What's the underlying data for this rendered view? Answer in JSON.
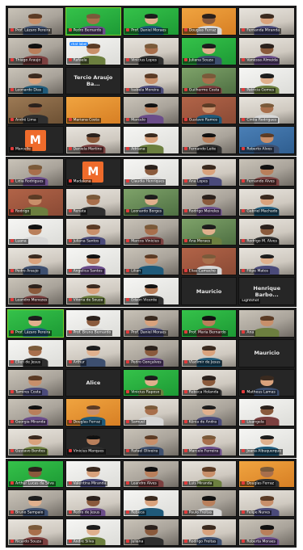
{
  "sheets": [
    {
      "tiles": [
        {
          "name": "Prof. Lázaro Pereira",
          "bg": "bg-office",
          "name_bind": "sheets.0.tiles.0.name"
        },
        {
          "name": "Pedro Bernardo",
          "bg": "bg-green",
          "active": true,
          "name_bind": "sheets.0.tiles.1.name"
        },
        {
          "name": "Prof. Daniel Moraes",
          "bg": "bg-green",
          "name_bind": "sheets.0.tiles.2.name"
        },
        {
          "name": "Douglas Ferraz",
          "bg": "bg-orange-room",
          "name_bind": "sheets.0.tiles.3.name"
        },
        {
          "name": "Fernanda Miranda",
          "bg": "bg-wall",
          "name_bind": "sheets.0.tiles.4.name"
        },
        {
          "name": "Thiago Araujo",
          "bg": "bg-office",
          "name_bind": "sheets.0.tiles.5.name"
        },
        {
          "name": "Rafaela",
          "bg": "bg-white",
          "chat": "chat label",
          "name_bind": "sheets.0.tiles.6.name"
        },
        {
          "name": "Vinicius Lopes",
          "bg": "bg-wall",
          "name_bind": "sheets.0.tiles.7.name"
        },
        {
          "name": "Juliana Souza",
          "bg": "bg-green",
          "name_bind": "sheets.0.tiles.8.name"
        },
        {
          "name": "Vanessa Almeida",
          "bg": "bg-wall",
          "name_bind": "sheets.0.tiles.9.name"
        },
        {
          "name": "Leonardo Dias",
          "bg": "bg-office",
          "name_bind": "sheets.0.tiles.10.name"
        },
        {
          "card": "Tercio Araujo Ba...",
          "name_bind": "sheets.0.tiles.11.card"
        },
        {
          "name": "Isabela Moreira",
          "bg": "bg-wall",
          "name_bind": "sheets.0.tiles.12.name"
        },
        {
          "name": "Guilherme Costa",
          "bg": "bg-plant",
          "name_bind": "sheets.0.tiles.13.name"
        },
        {
          "name": "Patricia Gomes",
          "bg": "bg-white",
          "name_bind": "sheets.0.tiles.14.name"
        },
        {
          "name": "André Lima",
          "bg": "bg-wood",
          "name_bind": "sheets.0.tiles.15.name"
        },
        {
          "name": "Mariana Costa",
          "bg": "bg-orange-room",
          "blank": true,
          "name_bind": "sheets.0.tiles.16.name"
        },
        {
          "name": "Marcelo",
          "bg": "bg-office",
          "name_bind": "sheets.0.tiles.17.name"
        },
        {
          "name": "Gustavo Ramos",
          "bg": "bg-brick",
          "name_bind": "sheets.0.tiles.18.name"
        },
        {
          "name": "Cintia Rodrigues",
          "bg": "bg-wall",
          "name_bind": "sheets.0.tiles.19.name"
        },
        {
          "name": "Marcelle",
          "avatar": "M",
          "name_bind": "sheets.0.tiles.20.name"
        },
        {
          "name": "Daniela Martins",
          "bg": "bg-wall",
          "name_bind": "sheets.0.tiles.21.name"
        },
        {
          "name": "Adriana",
          "bg": "bg-white",
          "name_bind": "sheets.0.tiles.22.name"
        },
        {
          "name": "Fernando Leite",
          "bg": "bg-office",
          "name_bind": "sheets.0.tiles.23.name"
        },
        {
          "name": "Roberto Alves",
          "bg": "bg-blue",
          "name_bind": "sheets.0.tiles.24.name"
        }
      ]
    },
    {
      "tiles": [
        {
          "name": "Lidia Rodrigues",
          "bg": "bg-office",
          "name_bind": "sheets.1.tiles.0.name"
        },
        {
          "name": "Madalena",
          "avatar": "M",
          "name_bind": "sheets.1.tiles.1.name"
        },
        {
          "name": "Claudia Henriques",
          "bg": "bg-white",
          "name_bind": "sheets.1.tiles.2.name"
        },
        {
          "name": "Ana Lopes",
          "bg": "bg-wall",
          "name_bind": "sheets.1.tiles.3.name"
        },
        {
          "name": "Fernando Alves",
          "bg": "bg-office",
          "name_bind": "sheets.1.tiles.4.name"
        },
        {
          "name": "Rodrigo",
          "bg": "bg-brick",
          "name_bind": "sheets.1.tiles.5.name"
        },
        {
          "name": "Renata",
          "bg": "bg-wall",
          "name_bind": "sheets.1.tiles.6.name"
        },
        {
          "name": "Leonardo Borges",
          "bg": "bg-plant",
          "name_bind": "sheets.1.tiles.7.name"
        },
        {
          "name": "Rodrigo Meireles",
          "bg": "bg-office",
          "name_bind": "sheets.1.tiles.8.name"
        },
        {
          "name": "Gabriel Machado",
          "bg": "bg-wall",
          "name_bind": "sheets.1.tiles.9.name"
        },
        {
          "name": "Luana",
          "bg": "bg-white",
          "name_bind": "sheets.1.tiles.10.name"
        },
        {
          "name": "Juliana Santos",
          "bg": "bg-wall",
          "name_bind": "sheets.1.tiles.11.name"
        },
        {
          "name": "Marcos Vinicius",
          "bg": "bg-office",
          "name_bind": "sheets.1.tiles.12.name"
        },
        {
          "name": "Ana Moraes",
          "bg": "bg-plant",
          "name_bind": "sheets.1.tiles.13.name"
        },
        {
          "name": "Rodrigo M. Alves",
          "bg": "bg-wall",
          "name_bind": "sheets.1.tiles.14.name"
        },
        {
          "name": "Pedro Araujo",
          "bg": "bg-wall",
          "name_bind": "sheets.1.tiles.15.name"
        },
        {
          "name": "Angelica Santos",
          "bg": "bg-white",
          "name_bind": "sheets.1.tiles.16.name"
        },
        {
          "name": "Lilian",
          "bg": "bg-office",
          "name_bind": "sheets.1.tiles.17.name"
        },
        {
          "name": "Elias Camacho",
          "bg": "bg-brick",
          "name_bind": "sheets.1.tiles.18.name"
        },
        {
          "name": "Filipe Matos",
          "bg": "bg-wall",
          "name_bind": "sheets.1.tiles.19.name"
        },
        {
          "name": "Leandro Menezes",
          "bg": "bg-office",
          "name_bind": "sheets.1.tiles.20.name"
        },
        {
          "name": "Vitoria de Souza",
          "bg": "bg-wall",
          "name_bind": "sheets.1.tiles.21.name"
        },
        {
          "name": "Edson Vicente",
          "bg": "bg-white",
          "name_bind": "sheets.1.tiles.22.name"
        },
        {
          "card": "Mauricio",
          "name_bind": "sheets.1.tiles.23.card"
        },
        {
          "card": "Henrique Barbo...",
          "sub": "Lightshot",
          "name_bind": "sheets.1.tiles.24.card"
        }
      ]
    },
    {
      "tiles": [
        {
          "name": "Prof. Lázaro Pereira",
          "bg": "bg-green",
          "active": true,
          "name_bind": "sheets.2.tiles.0.name"
        },
        {
          "name": "Prof. Bruno Bernardo",
          "bg": "bg-white",
          "name_bind": "sheets.2.tiles.1.name"
        },
        {
          "name": "Prof. Daniel Moraes",
          "bg": "bg-office",
          "name_bind": "sheets.2.tiles.2.name"
        },
        {
          "name": "Prof. Maria Bernardo",
          "bg": "bg-green",
          "name_bind": "sheets.2.tiles.3.name"
        },
        {
          "name": "Ana",
          "bg": "bg-office",
          "name_bind": "sheets.2.tiles.4.name"
        },
        {
          "name": "Ellen de Jesus",
          "bg": "bg-white",
          "name_bind": "sheets.2.tiles.5.name"
        },
        {
          "name": "Arthur",
          "bg": "bg-wall",
          "name_bind": "sheets.2.tiles.6.name"
        },
        {
          "name": "Pedro Gonçalves",
          "bg": "bg-office",
          "name_bind": "sheets.2.tiles.7.name"
        },
        {
          "name": "Vladimir de Jesus",
          "bg": "bg-wall",
          "name_bind": "sheets.2.tiles.8.name"
        },
        {
          "card": "Mauricio",
          "name_bind": "sheets.2.tiles.9.card"
        },
        {
          "name": "Tamires Costa",
          "bg": "bg-office",
          "name_bind": "sheets.2.tiles.10.name"
        },
        {
          "card": "Alice",
          "name_bind": "sheets.2.tiles.11.card"
        },
        {
          "name": "Vinicius Raposo",
          "bg": "bg-green",
          "name_bind": "sheets.2.tiles.12.name"
        },
        {
          "name": "Rebeca Holanda",
          "bg": "bg-wall",
          "name_bind": "sheets.2.tiles.13.name"
        },
        {
          "name": "Matheus Lamas",
          "bg": "bg-dark",
          "name_bind": "sheets.2.tiles.14.name"
        },
        {
          "name": "Georgia Miranda",
          "bg": "bg-office",
          "name_bind": "sheets.2.tiles.15.name"
        },
        {
          "name": "Douglas Ferraz",
          "bg": "bg-orange-room",
          "name_bind": "sheets.2.tiles.16.name"
        },
        {
          "name": "Samuel",
          "bg": "bg-wall",
          "name_bind": "sheets.2.tiles.17.name"
        },
        {
          "name": "Kênia de Andra",
          "bg": "bg-office",
          "name_bind": "sheets.2.tiles.18.name"
        },
        {
          "name": "Lisangela",
          "bg": "bg-white",
          "name_bind": "sheets.2.tiles.19.name"
        },
        {
          "name": "Gustavo Benites",
          "bg": "bg-wall",
          "name_bind": "sheets.2.tiles.20.name"
        },
        {
          "name": "Vinicius Marques",
          "bg": "bg-dark",
          "name_bind": "sheets.2.tiles.21.name"
        },
        {
          "name": "Rafael Oliveira",
          "bg": "bg-office",
          "name_bind": "sheets.2.tiles.22.name"
        },
        {
          "name": "Marcelo Ferreira",
          "bg": "bg-wall",
          "name_bind": "sheets.2.tiles.23.name"
        },
        {
          "name": "Joana Albuquerque",
          "bg": "bg-white",
          "name_bind": "sheets.2.tiles.24.name"
        }
      ]
    },
    {
      "tiles": [
        {
          "name": "Arthur Lucas da Silva",
          "bg": "bg-green",
          "name_bind": "sheets.3.tiles.0.name"
        },
        {
          "name": "Valentina Miranda",
          "bg": "bg-white",
          "name_bind": "sheets.3.tiles.1.name"
        },
        {
          "name": "Leandro Alves",
          "bg": "bg-office",
          "name_bind": "sheets.3.tiles.2.name"
        },
        {
          "name": "Luis Miranda",
          "bg": "bg-wall",
          "name_bind": "sheets.3.tiles.3.name"
        },
        {
          "name": "Douglas Ferraz",
          "bg": "bg-orange-room",
          "name_bind": "sheets.3.tiles.4.name"
        },
        {
          "name": "Bruno Sampaio",
          "bg": "bg-office",
          "name_bind": "sheets.3.tiles.5.name"
        },
        {
          "name": "Pedro de Jesus",
          "bg": "bg-wall",
          "name_bind": "sheets.3.tiles.6.name"
        },
        {
          "name": "Rebeca",
          "bg": "bg-white",
          "name_bind": "sheets.3.tiles.7.name"
        },
        {
          "name": "Paulo Freitas",
          "bg": "bg-office",
          "name_bind": "sheets.3.tiles.8.name"
        },
        {
          "name": "Felipe Nunes",
          "bg": "bg-wall",
          "name_bind": "sheets.3.tiles.9.name"
        },
        {
          "name": "Ricardo Souza",
          "bg": "bg-wall",
          "name_bind": "sheets.3.tiles.10.name"
        },
        {
          "name": "André Silva",
          "bg": "bg-white",
          "name_bind": "sheets.3.tiles.11.name"
        },
        {
          "name": "Juliana",
          "bg": "bg-office",
          "name_bind": "sheets.3.tiles.12.name"
        },
        {
          "name": "Rodrigo Freitas",
          "bg": "bg-wall",
          "name_bind": "sheets.3.tiles.13.name"
        },
        {
          "name": "Roberta Moraes",
          "bg": "bg-office",
          "name_bind": "sheets.3.tiles.14.name"
        }
      ]
    }
  ]
}
